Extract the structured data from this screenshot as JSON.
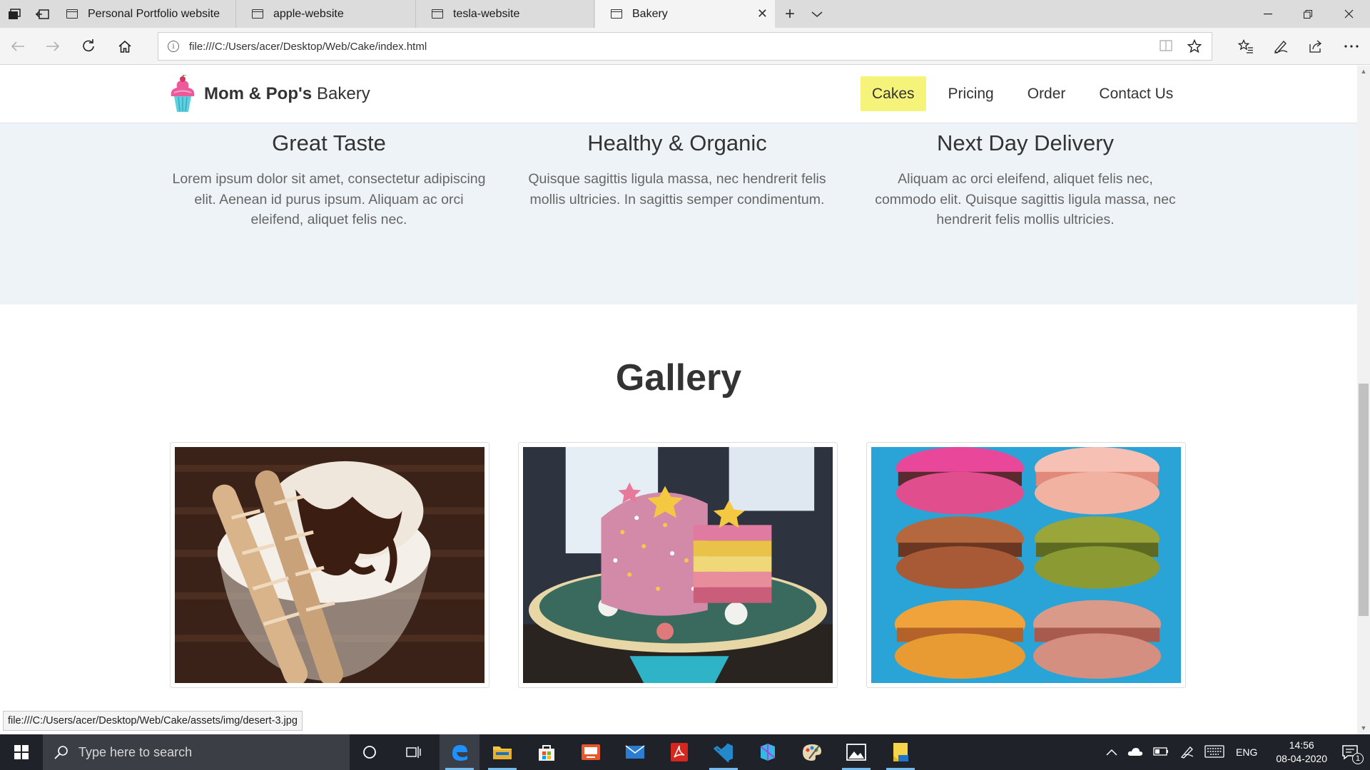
{
  "browser": {
    "tabs": [
      {
        "title": "Personal Portfolio website",
        "active": false
      },
      {
        "title": "apple-website",
        "active": false
      },
      {
        "title": "tesla-website",
        "active": false
      },
      {
        "title": "Bakery",
        "active": true
      }
    ],
    "new_tab_label": "+",
    "address": "file:///C:/Users/acer/Desktop/Web/Cake/index.html",
    "status_url": "file:///C:/Users/acer/Desktop/Web/Cake/assets/img/desert-3.jpg"
  },
  "site": {
    "brand_bold": "Mom & Pop's",
    "brand_rest": "Bakery",
    "menu": [
      "Cakes",
      "Pricing",
      "Order",
      "Contact Us"
    ],
    "active_menu": "Cakes",
    "features": [
      {
        "title": "Great Taste",
        "text": "Lorem ipsum dolor sit amet, consectetur adipiscing elit. Aenean id purus ipsum. Aliquam ac orci eleifend, aliquet felis nec."
      },
      {
        "title": "Healthy & Organic",
        "text": "Quisque sagittis ligula massa, nec hendrerit felis mollis ultricies. In sagittis semper condimentum."
      },
      {
        "title": "Next Day Delivery",
        "text": "Aliquam ac orci eleifend, aliquet felis nec, commodo elit. Quisque sagittis ligula massa, nec hendrerit felis mollis ultricies."
      }
    ],
    "gallery_title": "Gallery",
    "gallery_images": [
      "ice-cream-sundae-image",
      "sprinkle-layer-cake-image",
      "macarons-stack-image"
    ]
  },
  "taskbar": {
    "search_placeholder": "Type here to search",
    "language": "ENG",
    "time": "14:56",
    "date": "08-04-2020",
    "notification_count": "1"
  },
  "colors": {
    "accent_active_menu": "#f6f37b",
    "features_bg": "#edf3f6",
    "taskbar_bg": "#1f2329"
  }
}
